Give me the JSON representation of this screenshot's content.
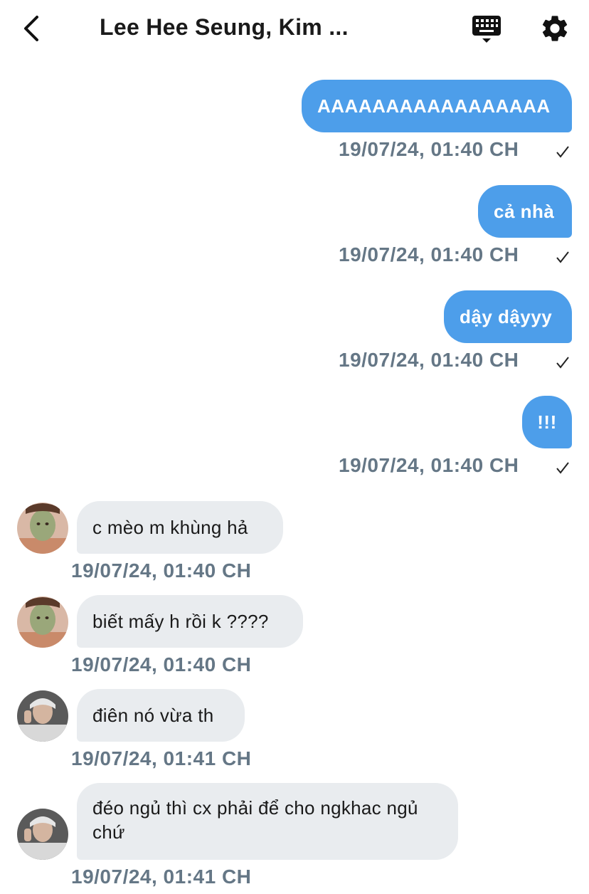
{
  "header": {
    "title": "Lee Hee Seung, Kim ...",
    "back_icon": "chevron-left-icon",
    "keyboard_icon": "keyboard-icon",
    "settings_icon": "gear-icon"
  },
  "colors": {
    "outgoing_bubble": "#4d9eea",
    "incoming_bubble": "#e9ecef",
    "timestamp": "#657786"
  },
  "messages": [
    {
      "direction": "out",
      "text": "AAAAAAAAAAAAAAAAA",
      "time": "19/07/24, 01:40 CH",
      "status": "sent"
    },
    {
      "direction": "out",
      "text": "cả nhà",
      "time": "19/07/24, 01:40 CH",
      "status": "sent"
    },
    {
      "direction": "out",
      "text": "dậy dậyyy",
      "time": "19/07/24, 01:40 CH",
      "status": "sent"
    },
    {
      "direction": "out",
      "text": "!!!",
      "time": "19/07/24, 01:40 CH",
      "status": "sent"
    },
    {
      "direction": "in",
      "text": "c mèo m khùng hả",
      "time": "19/07/24, 01:40 CH",
      "avatar": "avatar-1"
    },
    {
      "direction": "in",
      "text": "biết mấy h rồi k ????",
      "time": "19/07/24, 01:40 CH",
      "avatar": "avatar-1"
    },
    {
      "direction": "in",
      "text": "điên nó vừa th",
      "time": "19/07/24, 01:41 CH",
      "avatar": "avatar-2"
    },
    {
      "direction": "in",
      "text": "đéo ngủ thì cx phải để cho ngkhac ngủ chứ",
      "time": "19/07/24, 01:41 CH",
      "avatar": "avatar-2"
    }
  ]
}
